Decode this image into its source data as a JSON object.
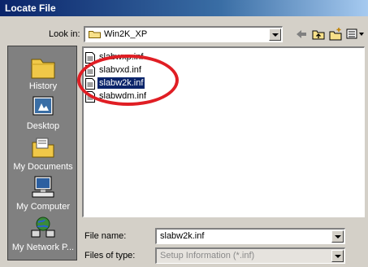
{
  "window": {
    "title": "Locate File"
  },
  "lookin": {
    "label": "Look in:",
    "value": "Win2K_XP"
  },
  "places": [
    {
      "label": "History",
      "icon": "history-icon"
    },
    {
      "label": "Desktop",
      "icon": "desktop-icon"
    },
    {
      "label": "My Documents",
      "icon": "my-documents-icon"
    },
    {
      "label": "My Computer",
      "icon": "my-computer-icon"
    },
    {
      "label": "My Network P...",
      "icon": "my-network-places-icon"
    }
  ],
  "files": [
    {
      "name": "slabwxp.inf",
      "selected": false
    },
    {
      "name": "slabvxd.inf",
      "selected": false
    },
    {
      "name": "slabw2k.inf",
      "selected": true
    },
    {
      "name": "slabwdm.inf",
      "selected": false
    }
  ],
  "filename": {
    "label": "File name:",
    "value": "slabw2k.inf"
  },
  "filetype": {
    "label": "Files of type:",
    "value": "Setup Information (*.inf)"
  },
  "colors": {
    "annotation": "#e01e24",
    "selection": "#0a246a",
    "titlebar": "#0a246a"
  }
}
